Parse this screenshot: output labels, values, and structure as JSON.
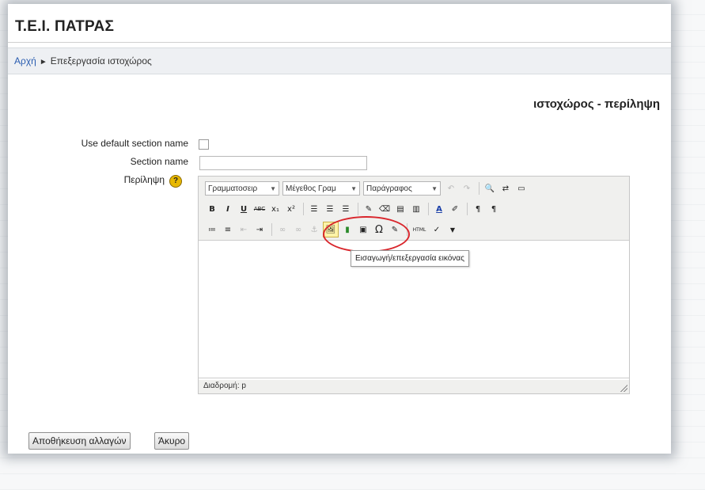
{
  "site": {
    "title": "Τ.Ε.Ι. ΠΑΤΡΑΣ"
  },
  "breadcrumb": {
    "home": "Αρχή",
    "separator": "►",
    "current": "Επεξεργασία ιστοχώρος"
  },
  "section_heading": "ιστοχώρος - περίληψη",
  "form": {
    "use_default_label": "Use default section name",
    "section_name_label": "Section name",
    "section_name_value": "",
    "summary_label": "Περίληψη",
    "help_icon": "?"
  },
  "editor": {
    "font_family_select": "Γραμματοσειρ",
    "font_size_select": "Μέγεθος Γραμ",
    "paragraph_select": "Παράγραφος",
    "path_label": "Διαδρομή: p",
    "tooltip": "Εισαγωγή/επεξεργασία εικόνας",
    "buttons": {
      "bold": "B",
      "italic": "I",
      "underline": "U",
      "strike": "ABC",
      "subscript": "x₁",
      "superscript": "x²",
      "omega": "Ω",
      "html": "HTML"
    }
  },
  "actions": {
    "save": "Αποθήκευση αλλαγών",
    "cancel": "Άκυρο"
  },
  "colors": {
    "link": "#2a5db0",
    "highlight": "#d9262c",
    "help": "#e8b800"
  }
}
